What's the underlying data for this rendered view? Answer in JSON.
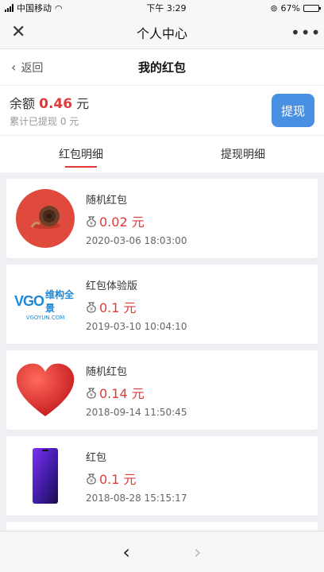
{
  "status": {
    "carrier": "中国移动",
    "time": "下午 3:29",
    "battery": "67%",
    "battery_level": 0.67
  },
  "wechat": {
    "title": "个人中心",
    "close_label": "✕",
    "more_label": "•••"
  },
  "subnav": {
    "back_label": "返回",
    "title": "我的红包"
  },
  "balance": {
    "label": "余额",
    "amount": "0.46",
    "unit": "元",
    "sub": "累计已提现 0 元",
    "button": "提现"
  },
  "tabs": [
    {
      "label": "红包明细"
    },
    {
      "label": "提现明细"
    }
  ],
  "items": [
    {
      "name": "随机红包",
      "amount": "0.02 元",
      "date": "2020-03-06 18:03:00",
      "thumb": "snail-avatar"
    },
    {
      "name": "红包体验版",
      "amount": "0.1 元",
      "date": "2019-03-10 10:04:10",
      "thumb": "vgo-logo",
      "logo": {
        "letters": "VGO",
        "cn": "维构全景",
        "url": "VGOYUN.COM"
      }
    },
    {
      "name": "随机红包",
      "amount": "0.14 元",
      "date": "2018-09-14 11:50:45",
      "thumb": "red-heart"
    },
    {
      "name": "红包",
      "amount": "0.1 元",
      "date": "2018-08-28 15:15:17",
      "thumb": "phone-image"
    }
  ],
  "bottom": {
    "back_icon": "‹",
    "forward_icon": "›"
  },
  "colors": {
    "accent": "#e03a3a",
    "button": "#4a90e2"
  }
}
